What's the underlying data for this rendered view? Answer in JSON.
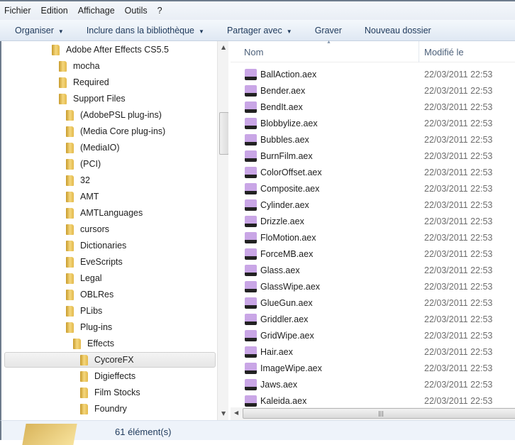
{
  "menu": [
    "Fichier",
    "Edition",
    "Affichage",
    "Outils",
    "?"
  ],
  "toolbar": [
    {
      "label": "Organiser",
      "dropdown": true
    },
    {
      "label": "Inclure dans la bibliothèque",
      "dropdown": true
    },
    {
      "label": "Partager avec",
      "dropdown": true
    },
    {
      "label": "Graver",
      "dropdown": false
    },
    {
      "label": "Nouveau dossier",
      "dropdown": false
    }
  ],
  "tree": [
    {
      "label": "Adobe After Effects CS5.5",
      "level": 0
    },
    {
      "label": "mocha",
      "level": 1
    },
    {
      "label": "Required",
      "level": 1
    },
    {
      "label": "Support Files",
      "level": 1
    },
    {
      "label": "(AdobePSL plug-ins)",
      "level": 2
    },
    {
      "label": "(Media Core plug-ins)",
      "level": 2
    },
    {
      "label": "(MediaIO)",
      "level": 2
    },
    {
      "label": "(PCI)",
      "level": 2
    },
    {
      "label": "32",
      "level": 2
    },
    {
      "label": "AMT",
      "level": 2
    },
    {
      "label": "AMTLanguages",
      "level": 2
    },
    {
      "label": "cursors",
      "level": 2
    },
    {
      "label": "Dictionaries",
      "level": 2
    },
    {
      "label": "EveScripts",
      "level": 2
    },
    {
      "label": "Legal",
      "level": 2
    },
    {
      "label": "OBLRes",
      "level": 2
    },
    {
      "label": "PLibs",
      "level": 2
    },
    {
      "label": "Plug-ins",
      "level": 2
    },
    {
      "label": "Effects",
      "level": 3
    },
    {
      "label": "CycoreFX",
      "level": 4,
      "selected": true
    },
    {
      "label": "Digieffects",
      "level": 4
    },
    {
      "label": "Film Stocks",
      "level": 4
    },
    {
      "label": "Foundry",
      "level": 4
    }
  ],
  "columns": {
    "name": "Nom",
    "modified": "Modifié le"
  },
  "files": [
    {
      "name": "BallAction.aex",
      "date": "22/03/2011 22:53"
    },
    {
      "name": "Bender.aex",
      "date": "22/03/2011 22:53"
    },
    {
      "name": "BendIt.aex",
      "date": "22/03/2011 22:53"
    },
    {
      "name": "Blobbylize.aex",
      "date": "22/03/2011 22:53"
    },
    {
      "name": "Bubbles.aex",
      "date": "22/03/2011 22:53"
    },
    {
      "name": "BurnFilm.aex",
      "date": "22/03/2011 22:53"
    },
    {
      "name": "ColorOffset.aex",
      "date": "22/03/2011 22:53"
    },
    {
      "name": "Composite.aex",
      "date": "22/03/2011 22:53"
    },
    {
      "name": "Cylinder.aex",
      "date": "22/03/2011 22:53"
    },
    {
      "name": "Drizzle.aex",
      "date": "22/03/2011 22:53"
    },
    {
      "name": "FloMotion.aex",
      "date": "22/03/2011 22:53"
    },
    {
      "name": "ForceMB.aex",
      "date": "22/03/2011 22:53"
    },
    {
      "name": "Glass.aex",
      "date": "22/03/2011 22:53"
    },
    {
      "name": "GlassWipe.aex",
      "date": "22/03/2011 22:53"
    },
    {
      "name": "GlueGun.aex",
      "date": "22/03/2011 22:53"
    },
    {
      "name": "Griddler.aex",
      "date": "22/03/2011 22:53"
    },
    {
      "name": "GridWipe.aex",
      "date": "22/03/2011 22:53"
    },
    {
      "name": "Hair.aex",
      "date": "22/03/2011 22:53"
    },
    {
      "name": "ImageWipe.aex",
      "date": "22/03/2011 22:53"
    },
    {
      "name": "Jaws.aex",
      "date": "22/03/2011 22:53"
    },
    {
      "name": "Kaleida.aex",
      "date": "22/03/2011 22:53"
    }
  ],
  "status": {
    "count": "61 élément(s)"
  }
}
